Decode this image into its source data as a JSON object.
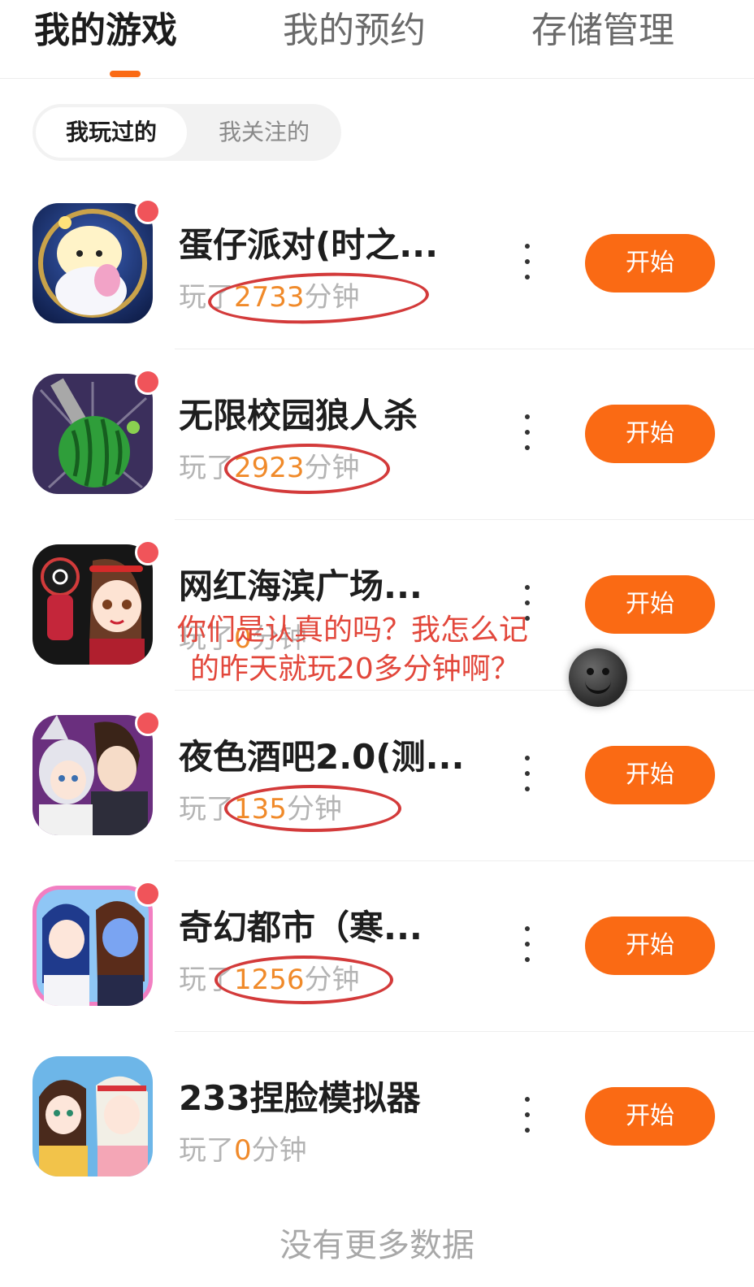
{
  "tabs": [
    {
      "label": "我的游戏",
      "active": true
    },
    {
      "label": "我的预约",
      "active": false
    },
    {
      "label": "存储管理",
      "active": false
    }
  ],
  "segment": {
    "active": "我玩过的",
    "inactive": "我关注的"
  },
  "games": [
    {
      "name": "蛋仔派对(时之...",
      "played_prefix": "玩了",
      "minutes": "2733",
      "unit": "分钟",
      "button": "开始",
      "icon": "eggy-party-icon"
    },
    {
      "name": "无限校园狼人杀",
      "played_prefix": "玩了",
      "minutes": "2923",
      "unit": "分钟",
      "button": "开始",
      "icon": "watermelon-knife-icon"
    },
    {
      "name": "网红海滨广场...",
      "played_prefix": "玩了",
      "minutes": "0",
      "unit": "分钟",
      "button": "开始",
      "icon": "anime-girl-squid-guard-icon"
    },
    {
      "name": "夜色酒吧2.0(测...",
      "played_prefix": "玩了",
      "minutes": "135",
      "unit": "分钟",
      "button": "开始",
      "icon": "catgirl-gentleman-icon"
    },
    {
      "name": "奇幻都市（寒...",
      "played_prefix": "玩了",
      "minutes": "1256",
      "unit": "分钟",
      "button": "开始",
      "icon": "fantasy-city-girls-icon"
    },
    {
      "name": "233捏脸模拟器",
      "played_prefix": "玩了",
      "minutes": "0",
      "unit": "分钟",
      "button": "开始",
      "icon": "face-maker-girls-icon"
    }
  ],
  "annotation": {
    "line1": "你们是认真的吗？我怎么记",
    "line2": "的昨天就玩20多分钟啊？"
  },
  "footer": "没有更多数据",
  "colors": {
    "accent": "#fa6a14",
    "badge": "#f0545a",
    "minutes": "#f08a2a",
    "annotation": "#e2473b"
  }
}
